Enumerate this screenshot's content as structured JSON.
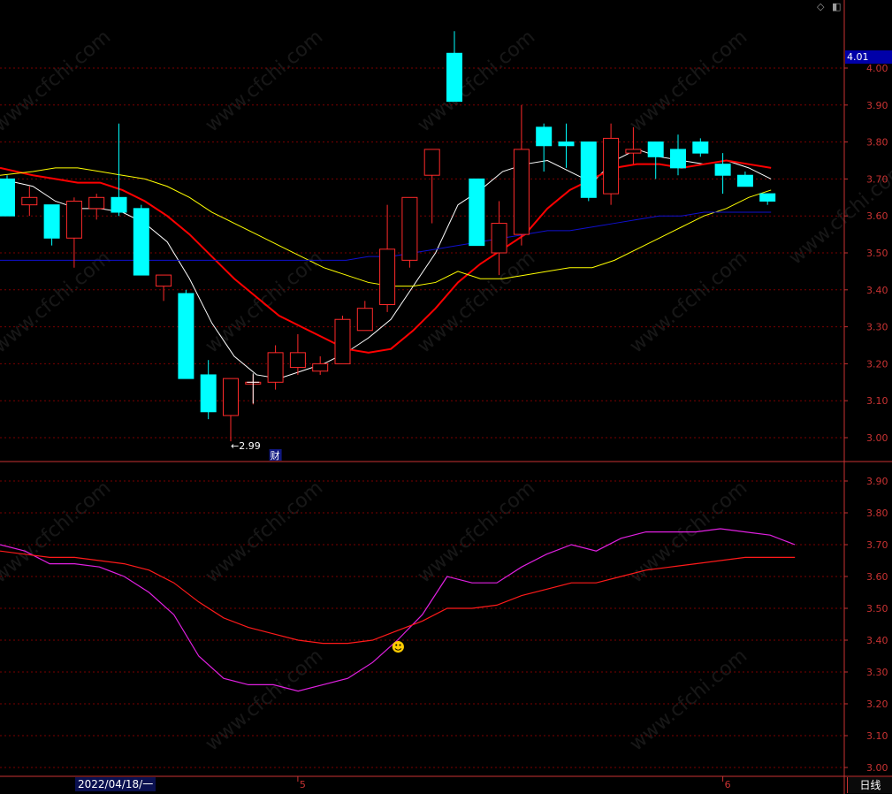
{
  "chart_data": [
    {
      "type": "candlestick",
      "panel": "main",
      "ylim": [
        2.95,
        4.05
      ],
      "yticks": [
        "4.00",
        "3.90",
        "3.80",
        "3.70",
        "3.60",
        "3.50",
        "3.40",
        "3.30",
        "3.20",
        "3.10",
        "3.00"
      ],
      "candles": [
        {
          "o": 3.7,
          "h": 3.71,
          "l": 3.6,
          "c": 3.6
        },
        {
          "o": 3.63,
          "h": 3.68,
          "l": 3.6,
          "c": 3.65
        },
        {
          "o": 3.63,
          "h": 3.63,
          "l": 3.52,
          "c": 3.54
        },
        {
          "o": 3.54,
          "h": 3.65,
          "l": 3.46,
          "c": 3.64
        },
        {
          "o": 3.62,
          "h": 3.66,
          "l": 3.59,
          "c": 3.65
        },
        {
          "o": 3.65,
          "h": 3.85,
          "l": 3.6,
          "c": 3.61
        },
        {
          "o": 3.62,
          "h": 3.63,
          "l": 3.44,
          "c": 3.44
        },
        {
          "o": 3.41,
          "h": 3.44,
          "l": 3.37,
          "c": 3.44
        },
        {
          "o": 3.39,
          "h": 3.4,
          "l": 3.16,
          "c": 3.16
        },
        {
          "o": 3.17,
          "h": 3.21,
          "l": 3.05,
          "c": 3.07
        },
        {
          "o": 3.06,
          "h": 3.16,
          "l": 2.99,
          "c": 3.16
        },
        {
          "o": 3.15,
          "h": 3.17,
          "l": 3.09,
          "c": 3.15
        },
        {
          "o": 3.15,
          "h": 3.25,
          "l": 3.13,
          "c": 3.23
        },
        {
          "o": 3.19,
          "h": 3.28,
          "l": 3.17,
          "c": 3.23
        },
        {
          "o": 3.18,
          "h": 3.22,
          "l": 3.17,
          "c": 3.2
        },
        {
          "o": 3.2,
          "h": 3.33,
          "l": 3.2,
          "c": 3.32
        },
        {
          "o": 3.29,
          "h": 3.37,
          "l": 3.29,
          "c": 3.35
        },
        {
          "o": 3.36,
          "h": 3.63,
          "l": 3.34,
          "c": 3.51
        },
        {
          "o": 3.48,
          "h": 3.65,
          "l": 3.46,
          "c": 3.65
        },
        {
          "o": 3.71,
          "h": 3.78,
          "l": 3.58,
          "c": 3.78
        },
        {
          "o": 4.04,
          "h": 4.1,
          "l": 3.91,
          "c": 3.91
        },
        {
          "o": 3.7,
          "h": 3.7,
          "l": 3.52,
          "c": 3.52
        },
        {
          "o": 3.5,
          "h": 3.64,
          "l": 3.44,
          "c": 3.58
        },
        {
          "o": 3.55,
          "h": 3.9,
          "l": 3.52,
          "c": 3.78
        },
        {
          "o": 3.84,
          "h": 3.85,
          "l": 3.72,
          "c": 3.79
        },
        {
          "o": 3.8,
          "h": 3.85,
          "l": 3.73,
          "c": 3.79
        },
        {
          "o": 3.8,
          "h": 3.8,
          "l": 3.64,
          "c": 3.65
        },
        {
          "o": 3.66,
          "h": 3.85,
          "l": 3.63,
          "c": 3.81
        },
        {
          "o": 3.77,
          "h": 3.84,
          "l": 3.74,
          "c": 3.78
        },
        {
          "o": 3.8,
          "h": 3.8,
          "l": 3.7,
          "c": 3.76
        },
        {
          "o": 3.78,
          "h": 3.82,
          "l": 3.71,
          "c": 3.73
        },
        {
          "o": 3.8,
          "h": 3.81,
          "l": 3.76,
          "c": 3.77
        },
        {
          "o": 3.74,
          "h": 3.77,
          "l": 3.66,
          "c": 3.71
        },
        {
          "o": 3.71,
          "h": 3.72,
          "l": 3.68,
          "c": 3.68
        },
        {
          "o": 3.66,
          "h": 3.66,
          "l": 3.63,
          "c": 3.64
        }
      ],
      "ma_lines": [
        {
          "color": "#ffffff",
          "width": 1,
          "values": [
            3.7,
            3.68,
            3.64,
            3.62,
            3.62,
            3.61,
            3.58,
            3.53,
            3.43,
            3.31,
            3.22,
            3.17,
            3.16,
            3.18,
            3.2,
            3.23,
            3.27,
            3.32,
            3.41,
            3.5,
            3.63,
            3.67,
            3.72,
            3.74,
            3.75,
            3.72,
            3.69,
            3.75,
            3.78,
            3.76,
            3.75,
            3.74,
            3.75,
            3.73,
            3.7
          ]
        },
        {
          "color": "#ff0000",
          "width": 2,
          "values": [
            3.73,
            3.71,
            3.7,
            3.69,
            3.69,
            3.67,
            3.64,
            3.6,
            3.55,
            3.49,
            3.43,
            3.38,
            3.33,
            3.3,
            3.27,
            3.24,
            3.23,
            3.24,
            3.29,
            3.35,
            3.42,
            3.47,
            3.51,
            3.55,
            3.62,
            3.67,
            3.7,
            3.73,
            3.74,
            3.74,
            3.73,
            3.74,
            3.75,
            3.74,
            3.73
          ]
        },
        {
          "color": "#ffff00",
          "width": 1,
          "values": [
            3.71,
            3.72,
            3.73,
            3.73,
            3.72,
            3.71,
            3.7,
            3.68,
            3.65,
            3.61,
            3.58,
            3.55,
            3.52,
            3.49,
            3.46,
            3.44,
            3.42,
            3.41,
            3.41,
            3.42,
            3.45,
            3.43,
            3.43,
            3.44,
            3.45,
            3.46,
            3.46,
            3.48,
            3.51,
            3.54,
            3.57,
            3.6,
            3.62,
            3.65,
            3.67
          ]
        },
        {
          "color": "#1010d0",
          "width": 1,
          "values": [
            3.48,
            3.48,
            3.48,
            3.48,
            3.48,
            3.48,
            3.48,
            3.48,
            3.48,
            3.48,
            3.48,
            3.48,
            3.48,
            3.48,
            3.48,
            3.48,
            3.49,
            3.49,
            3.5,
            3.51,
            3.52,
            3.53,
            3.54,
            3.55,
            3.56,
            3.56,
            3.57,
            3.58,
            3.59,
            3.6,
            3.6,
            3.61,
            3.61,
            3.61,
            3.61
          ]
        }
      ],
      "annotations": {
        "low_label": "←2.99",
        "low_value": 2.99,
        "low_index": 10,
        "event_label": "财",
        "event_index": 12
      },
      "last_price_tag": "4.01"
    },
    {
      "type": "line",
      "panel": "indicator",
      "ylim": [
        2.97,
        3.95
      ],
      "yticks": [
        "3.90",
        "3.80",
        "3.70",
        "3.60",
        "3.50",
        "3.40",
        "3.30",
        "3.20",
        "3.10",
        "3.00"
      ],
      "series": [
        {
          "color": "#e020e0",
          "values": [
            3.7,
            3.68,
            3.64,
            3.64,
            3.63,
            3.6,
            3.55,
            3.48,
            3.35,
            3.28,
            3.26,
            3.26,
            3.24,
            3.26,
            3.28,
            3.33,
            3.4,
            3.48,
            3.6,
            3.58,
            3.58,
            3.63,
            3.67,
            3.7,
            3.68,
            3.72,
            3.74,
            3.74,
            3.74,
            3.75,
            3.74,
            3.73,
            3.7
          ]
        },
        {
          "color": "#ff1a1a",
          "values": [
            3.68,
            3.67,
            3.66,
            3.66,
            3.65,
            3.64,
            3.62,
            3.58,
            3.52,
            3.47,
            3.44,
            3.42,
            3.4,
            3.39,
            3.39,
            3.4,
            3.43,
            3.46,
            3.5,
            3.5,
            3.51,
            3.54,
            3.56,
            3.58,
            3.58,
            3.6,
            3.62,
            3.63,
            3.64,
            3.65,
            3.66,
            3.66,
            3.66
          ]
        }
      ],
      "marker": {
        "symbol": "☻",
        "index": 16,
        "value": 3.38
      }
    }
  ],
  "x_axis": {
    "date_label": "2022/04/18/一",
    "month_marks": [
      {
        "label": "5",
        "index": 13
      },
      {
        "label": "6",
        "index": 32
      }
    ]
  },
  "period_label": "日线",
  "watermark": "www.cfchi.com",
  "colors": {
    "up": "#ff2a2a",
    "down": "#00ffff",
    "grid": "#7a0000",
    "border": "#c83232"
  }
}
